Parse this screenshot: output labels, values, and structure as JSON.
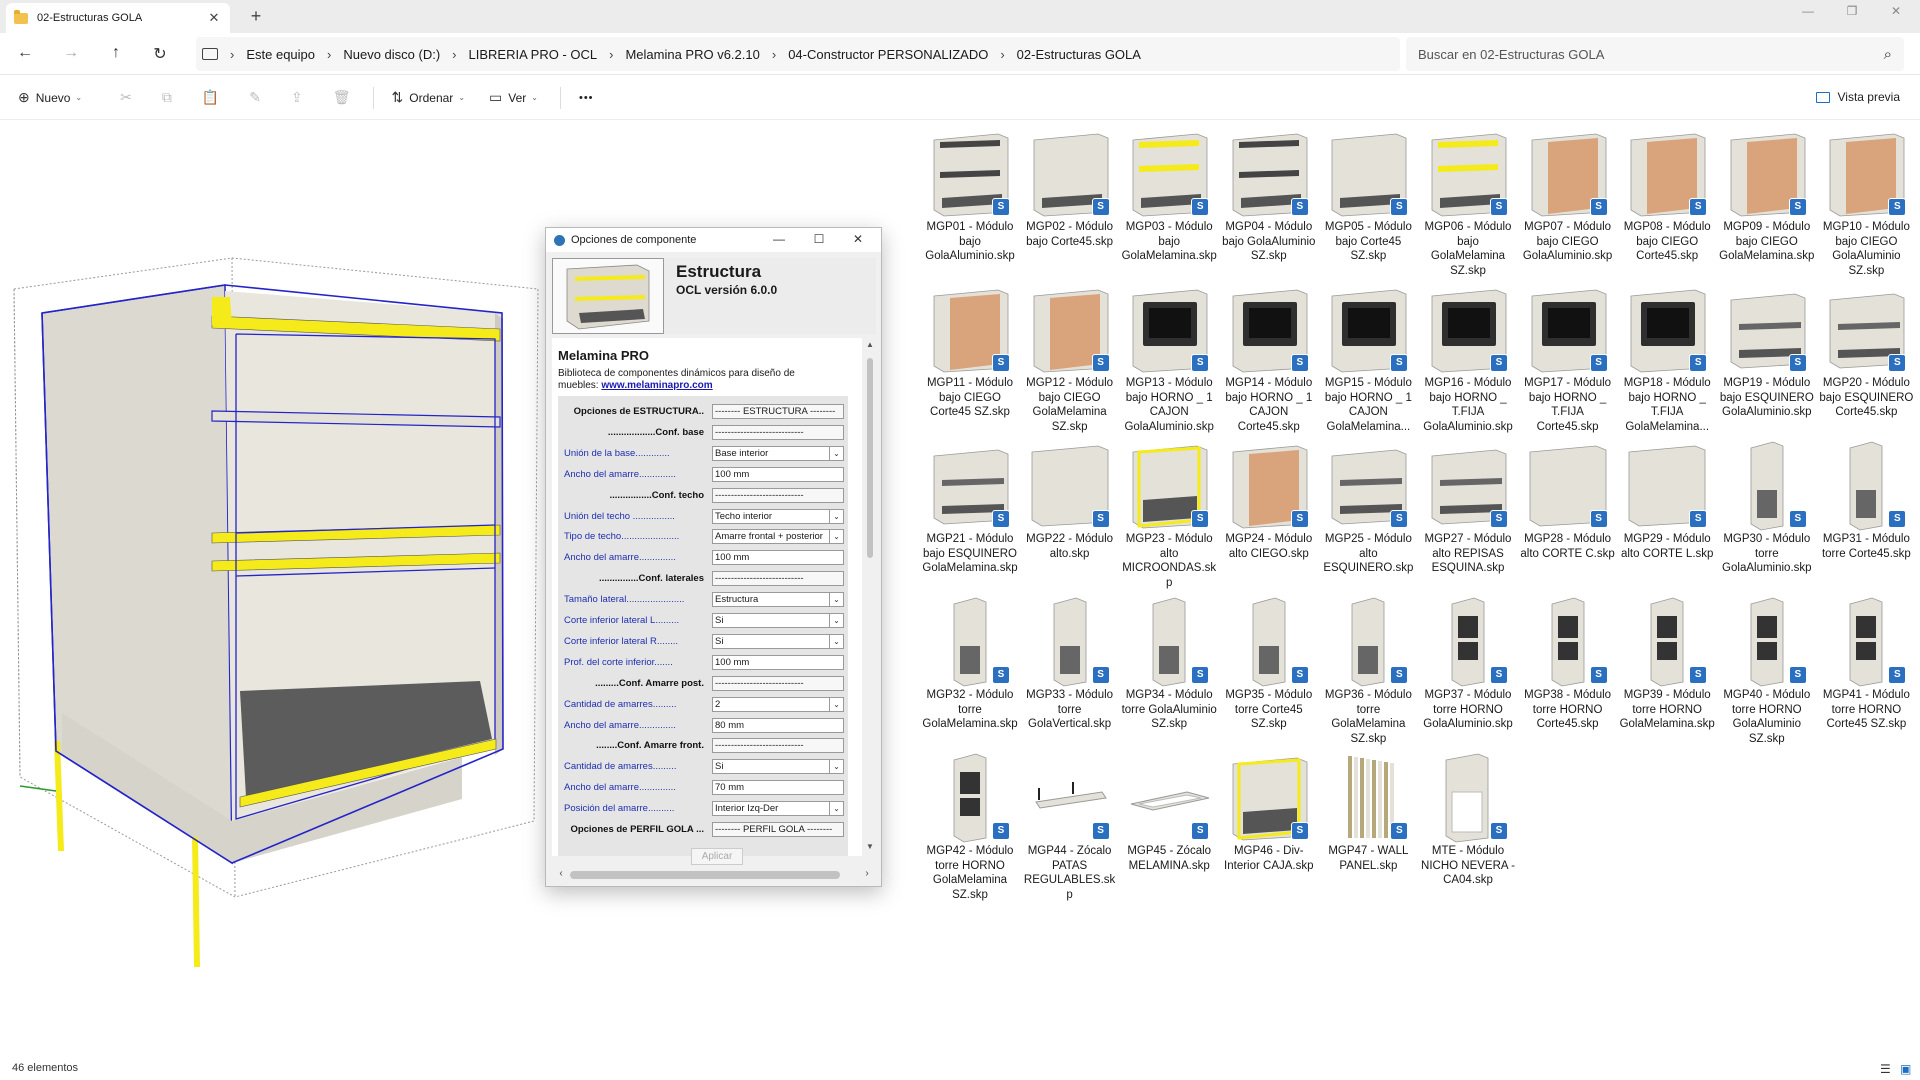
{
  "window": {
    "tab_title": "02-Estructuras GOLA",
    "tab_close_icon": "close-icon",
    "new_tab_glyph": "+",
    "minimize_glyph": "—",
    "maximize_glyph": "❐",
    "close_glyph": "✕"
  },
  "nav": {
    "back_glyph": "←",
    "forward_glyph": "→",
    "up_glyph": "↑",
    "refresh_glyph": "↻"
  },
  "breadcrumb": {
    "items": [
      "Este equipo",
      "Nuevo disco (D:)",
      "LIBRERIA PRO - OCL",
      "Melamina PRO v6.2.10",
      "04-Constructor PERSONALIZADO",
      "02-Estructuras GOLA"
    ],
    "separator": "›"
  },
  "search": {
    "placeholder": "Buscar en 02-Estructuras GOLA",
    "icon_glyph": "⌕"
  },
  "toolbar": {
    "new_label": "Nuevo",
    "sort_label": "Ordenar",
    "view_label": "Ver",
    "more_glyph": "•••",
    "preview_label": "Vista previa",
    "caret_glyph": "⌄"
  },
  "dialog": {
    "title": "Opciones de componente",
    "minimize_glyph": "—",
    "maximize_glyph": "☐",
    "close_glyph": "✕",
    "component_name": "Estructura",
    "version": "OCL versión 6.0.0",
    "brand_title": "Melamina PRO",
    "description": "Biblioteca de componentes dinámicos para diseño de muebles:",
    "link_text": "www.melaminapro.com",
    "apply_label": "Aplicar",
    "dropdown_glyph": "⌄",
    "options": [
      {
        "label": "Opciones de ESTRUCTURA..",
        "value": "-------- ESTRUCTURA --------",
        "kind": "section",
        "dropdown": false
      },
      {
        "label": "..................Conf. base",
        "value": "----------------------------",
        "kind": "section",
        "dropdown": false
      },
      {
        "label": "Unión de la base.............",
        "value": "Base interior",
        "kind": "field",
        "dropdown": true
      },
      {
        "label": "Ancho del amarre..............",
        "value": "100 mm",
        "kind": "field",
        "dropdown": false
      },
      {
        "label": "................Conf. techo",
        "value": "----------------------------",
        "kind": "section",
        "dropdown": false
      },
      {
        "label": "Unión del techo ................",
        "value": "Techo interior",
        "kind": "field",
        "dropdown": true
      },
      {
        "label": "Tipo de techo......................",
        "value": "Amarre frontal + posterior",
        "kind": "field",
        "dropdown": true
      },
      {
        "label": "Ancho del amarre..............",
        "value": "100 mm",
        "kind": "field",
        "dropdown": false
      },
      {
        "label": "...............Conf. laterales",
        "value": "----------------------------",
        "kind": "section",
        "dropdown": false
      },
      {
        "label": "Tamaño lateral......................",
        "value": "Estructura",
        "kind": "field",
        "dropdown": true
      },
      {
        "label": "Corte inferior lateral L.........",
        "value": "Si",
        "kind": "field",
        "dropdown": true
      },
      {
        "label": "Corte inferior lateral R........",
        "value": "Si",
        "kind": "field",
        "dropdown": true
      },
      {
        "label": "Prof. del corte inferior.......",
        "value": "100 mm",
        "kind": "field",
        "dropdown": false
      },
      {
        "label": ".........Conf. Amarre post.",
        "value": "----------------------------",
        "kind": "section",
        "dropdown": false
      },
      {
        "label": "Cantidad de amarres.........",
        "value": "2",
        "kind": "field",
        "dropdown": true
      },
      {
        "label": "Ancho del amarre..............",
        "value": "80 mm",
        "kind": "field",
        "dropdown": false
      },
      {
        "label": "........Conf. Amarre front.",
        "value": "----------------------------",
        "kind": "section",
        "dropdown": false
      },
      {
        "label": "Cantidad de amarres.........",
        "value": "Si",
        "kind": "field",
        "dropdown": true
      },
      {
        "label": "Ancho del amarre..............",
        "value": "70 mm",
        "kind": "field",
        "dropdown": false
      },
      {
        "label": "Posición del amarre..........",
        "value": "Interior Izq-Der",
        "kind": "field",
        "dropdown": true
      },
      {
        "label": "Opciones de PERFIL GOLA ...",
        "value": "-------- PERFIL GOLA --------",
        "kind": "section",
        "dropdown": false
      }
    ]
  },
  "files": [
    {
      "name": "MGP01 - Módulo bajo GolaAluminio.skp",
      "icon": "base-cabinet-drawer-rail"
    },
    {
      "name": "MGP02 - Módulo bajo Corte45.skp",
      "icon": "base-cabinet-plain"
    },
    {
      "name": "MGP03 - Módulo bajo GolaMelamina.skp",
      "icon": "base-cabinet-gola-yellow"
    },
    {
      "name": "MGP04 - Módulo bajo GolaAluminio SZ.skp",
      "icon": "base-cabinet-drawer-rail"
    },
    {
      "name": "MGP05 - Módulo bajo Corte45 SZ.skp",
      "icon": "base-cabinet-plain"
    },
    {
      "name": "MGP06 - Módulo bajo GolaMelamina SZ.skp",
      "icon": "base-cabinet-gola-yellow"
    },
    {
      "name": "MGP07 - Módulo bajo CIEGO GolaAluminio.skp",
      "icon": "blind-corner-cabinet"
    },
    {
      "name": "MGP08 - Módulo bajo CIEGO Corte45.skp",
      "icon": "blind-corner-cabinet"
    },
    {
      "name": "MGP09 - Módulo bajo CIEGO GolaMelamina.skp",
      "icon": "blind-corner-cabinet"
    },
    {
      "name": "MGP10 - Módulo bajo CIEGO GolaAluminio SZ.skp",
      "icon": "blind-corner-cabinet"
    },
    {
      "name": "MGP11 - Módulo bajo CIEGO Corte45 SZ.skp",
      "icon": "blind-corner-cabinet"
    },
    {
      "name": "MGP12 - Módulo bajo CIEGO GolaMelamina SZ.skp",
      "icon": "blind-corner-cabinet"
    },
    {
      "name": "MGP13 - Módulo bajo HORNO _ 1 CAJON GolaAluminio.skp",
      "icon": "oven-cabinet"
    },
    {
      "name": "MGP14 - Módulo bajo HORNO _ 1 CAJON Corte45.skp",
      "icon": "oven-cabinet"
    },
    {
      "name": "MGP15 - Módulo bajo HORNO _ 1 CAJON GolaMelamina...",
      "icon": "oven-cabinet"
    },
    {
      "name": "MGP16 - Módulo bajo HORNO _ T.FIJA GolaAluminio.skp",
      "icon": "oven-cabinet"
    },
    {
      "name": "MGP17 - Módulo bajo HORNO _ T.FIJA Corte45.skp",
      "icon": "oven-cabinet"
    },
    {
      "name": "MGP18 - Módulo bajo HORNO _ T.FIJA GolaMelamina...",
      "icon": "oven-cabinet"
    },
    {
      "name": "MGP19 - Módulo bajo ESQUINERO GolaAluminio.skp",
      "icon": "corner-cabinet"
    },
    {
      "name": "MGP20 - Módulo bajo ESQUINERO Corte45.skp",
      "icon": "corner-cabinet"
    },
    {
      "name": "MGP21 - Módulo bajo ESQUINERO GolaMelamina.skp",
      "icon": "corner-cabinet"
    },
    {
      "name": "MGP22 - Módulo alto.skp",
      "icon": "wall-cabinet"
    },
    {
      "name": "MGP23 - Módulo alto MICROONDAS.skp",
      "icon": "microwave-cabinet"
    },
    {
      "name": "MGP24 - Módulo alto CIEGO.skp",
      "icon": "blind-wall-cabinet"
    },
    {
      "name": "MGP25 - Módulo alto ESQUINERO.skp",
      "icon": "corner-cabinet"
    },
    {
      "name": "MGP27 - Módulo alto REPISAS ESQUINA.skp",
      "icon": "corner-shelf-cabinet"
    },
    {
      "name": "MGP28 - Módulo alto CORTE C.skp",
      "icon": "wall-cabinet-wide"
    },
    {
      "name": "MGP29 - Módulo alto CORTE L.skp",
      "icon": "wall-cabinet-wide"
    },
    {
      "name": "MGP30 - Módulo torre GolaAluminio.skp",
      "icon": "tall-cabinet"
    },
    {
      "name": "MGP31 - Módulo torre Corte45.skp",
      "icon": "tall-cabinet"
    },
    {
      "name": "MGP32 - Módulo torre GolaMelamina.skp",
      "icon": "tall-cabinet"
    },
    {
      "name": "MGP33 - Módulo torre GolaVertical.skp",
      "icon": "tall-cabinet"
    },
    {
      "name": "MGP34 - Módulo torre GolaAluminio SZ.skp",
      "icon": "tall-cabinet"
    },
    {
      "name": "MGP35 - Módulo torre Corte45 SZ.skp",
      "icon": "tall-cabinet"
    },
    {
      "name": "MGP36 - Módulo torre GolaMelamina SZ.skp",
      "icon": "tall-cabinet"
    },
    {
      "name": "MGP37 - Módulo torre HORNO GolaAluminio.skp",
      "icon": "tall-oven-cabinet"
    },
    {
      "name": "MGP38 - Módulo torre HORNO Corte45.skp",
      "icon": "tall-oven-cabinet"
    },
    {
      "name": "MGP39 - Módulo torre HORNO GolaMelamina.skp",
      "icon": "tall-oven-cabinet"
    },
    {
      "name": "MGP40 - Módulo torre HORNO GolaAluminio SZ.skp",
      "icon": "tall-oven-cabinet"
    },
    {
      "name": "MGP41 - Módulo torre HORNO Corte45 SZ.skp",
      "icon": "tall-oven-cabinet"
    },
    {
      "name": "MGP42 - Módulo torre HORNO GolaMelamina SZ.skp",
      "icon": "tall-oven-cabinet"
    },
    {
      "name": "MGP44 - Zócalo PATAS REGULABLES.skp",
      "icon": "plinth-legs"
    },
    {
      "name": "MGP45 - Zócalo MELAMINA.skp",
      "icon": "plinth-frame"
    },
    {
      "name": "MGP46 - Div-Interior CAJA.skp",
      "icon": "interior-box"
    },
    {
      "name": "MGP47 - WALL PANEL.skp",
      "icon": "wall-panel"
    },
    {
      "name": "MTE - Módulo NICHO NEVERA - CA04.skp",
      "icon": "fridge-niche"
    }
  ],
  "file_badge_glyph": "S",
  "status": {
    "count_text": "46 elementos",
    "details_glyph": "☰",
    "tiles_glyph": "▣"
  },
  "colors": {
    "accent": "#1b6ec2",
    "sketchup_badge": "#2a6fc0",
    "gola_profile": "#f5ea1a",
    "wood": "#e4e1d8",
    "selection_edges": "#2424c8"
  }
}
